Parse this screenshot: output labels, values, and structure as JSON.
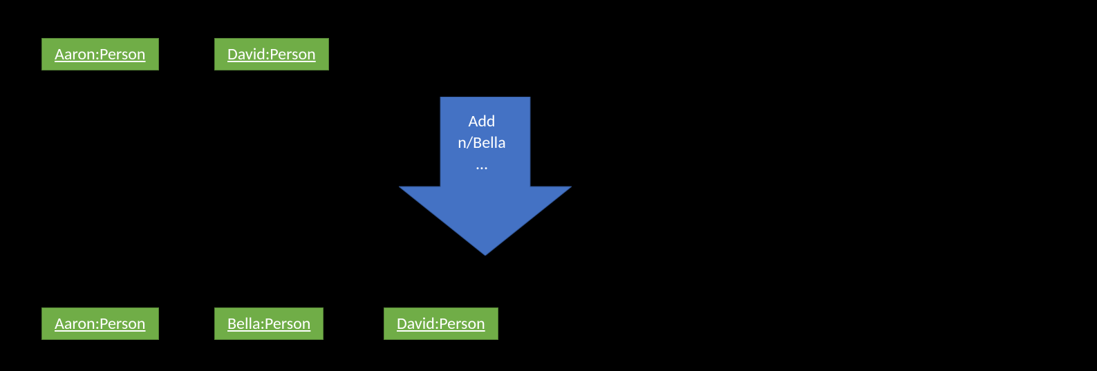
{
  "before": {
    "persons": [
      {
        "label": "Aaron:Person"
      },
      {
        "label": "David:Person"
      }
    ]
  },
  "arrow": {
    "line1": "Add",
    "line2": "n/Bella",
    "line3": "…",
    "fill": "#4472C4",
    "stroke": "#2F528F"
  },
  "after": {
    "persons": [
      {
        "label": "Aaron:Person"
      },
      {
        "label": "Bella:Person"
      },
      {
        "label": "David:Person"
      }
    ]
  },
  "colors": {
    "background": "#000000",
    "boxFill": "#70AD47",
    "boxBorder": "#548235",
    "text": "#FFFFFF"
  }
}
